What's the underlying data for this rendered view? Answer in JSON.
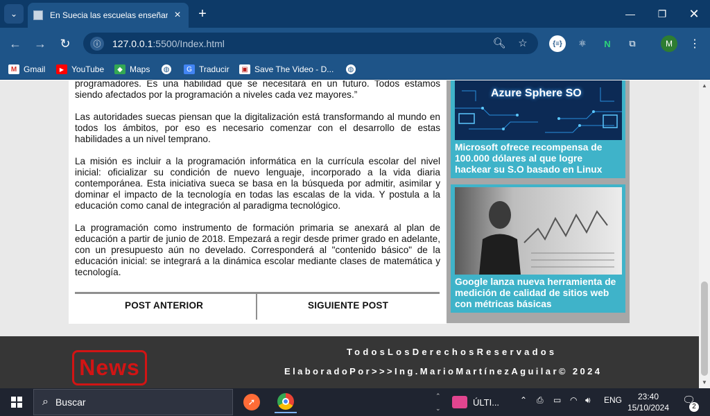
{
  "browser": {
    "tab_title": "En Suecia las escuelas enseñará",
    "url_host": "127.0.0.1",
    "url_rest": ":5500/Index.html",
    "profile_initial": "M",
    "bookmarks": [
      {
        "label": "Gmail",
        "icon": "gmail-icon"
      },
      {
        "label": "YouTube",
        "icon": "youtube-icon"
      },
      {
        "label": "Maps",
        "icon": "maps-icon"
      },
      {
        "label": "",
        "icon": "globe-icon"
      },
      {
        "label": "Traducir",
        "icon": "translate-icon"
      },
      {
        "label": "Save The Video - D...",
        "icon": "savethevideo-icon"
      },
      {
        "label": "",
        "icon": "globe-icon"
      }
    ]
  },
  "article": {
    "paragraphs": [
      "programadores. Es una habilidad que se necesitará en un futuro. Todos estamos siendo afectados por la programación a niveles cada vez mayores.”",
      "Las autoridades suecas piensan que la digitalización está transformando al mundo en todos los ámbitos, por eso es necesario comenzar con el desarrollo de estas habilidades a un nivel temprano.",
      "La misión es incluir a la programación informática en la currícula escolar del nivel inicial: oficializar su condición de nuevo lenguaje, incorporado a la vida diaria contemporánea. Esta iniciativa sueca se basa en la búsqueda por admitir, asimilar y dominar el impacto de la tecnología en todas las escalas de la vida. Y postula a la educación como canal de integración al paradigma tecnológico.",
      "La programación como instrumento de formación primaria se anexará al plan de educación a partir de junio de 2018. Empezará a regir desde primer grado en adelante, con un presupuesto aún no develado. Corresponderá al \"contenido básico\" de la educación inicial: se integrará a la dinámica escolar mediante clases de matemática y tecnología."
    ],
    "prev_label": "POST ANTERIOR",
    "next_label": "SIGUIENTE POST"
  },
  "sidebar": {
    "card1": {
      "image_text": "Azure Sphere SO",
      "title": "Microsoft ofrece recompensa de 100.000 dólares al que logre hackear su S.O basado en Linux"
    },
    "card2": {
      "title": "Google lanza nueva herramienta de medición de calidad de sitios web con métricas básicas"
    }
  },
  "footer": {
    "line1": "TodosLosDerechosReservados",
    "line2": "ElaboradoPor>>>Ing.MarioMartínezAguilar© 2024",
    "logo_text": "News"
  },
  "taskbar": {
    "search_label": "Buscar",
    "app_label": "ÚLTI...",
    "language": "ENG",
    "time": "23:40",
    "date": "15/10/2024",
    "notification_count": "2"
  },
  "colors": {
    "tabbar": "#0d3a68",
    "toolbar": "#1e5488",
    "card_bg": "#3fb3c9",
    "footer_bg": "#363636",
    "logo_red": "#d21414"
  }
}
